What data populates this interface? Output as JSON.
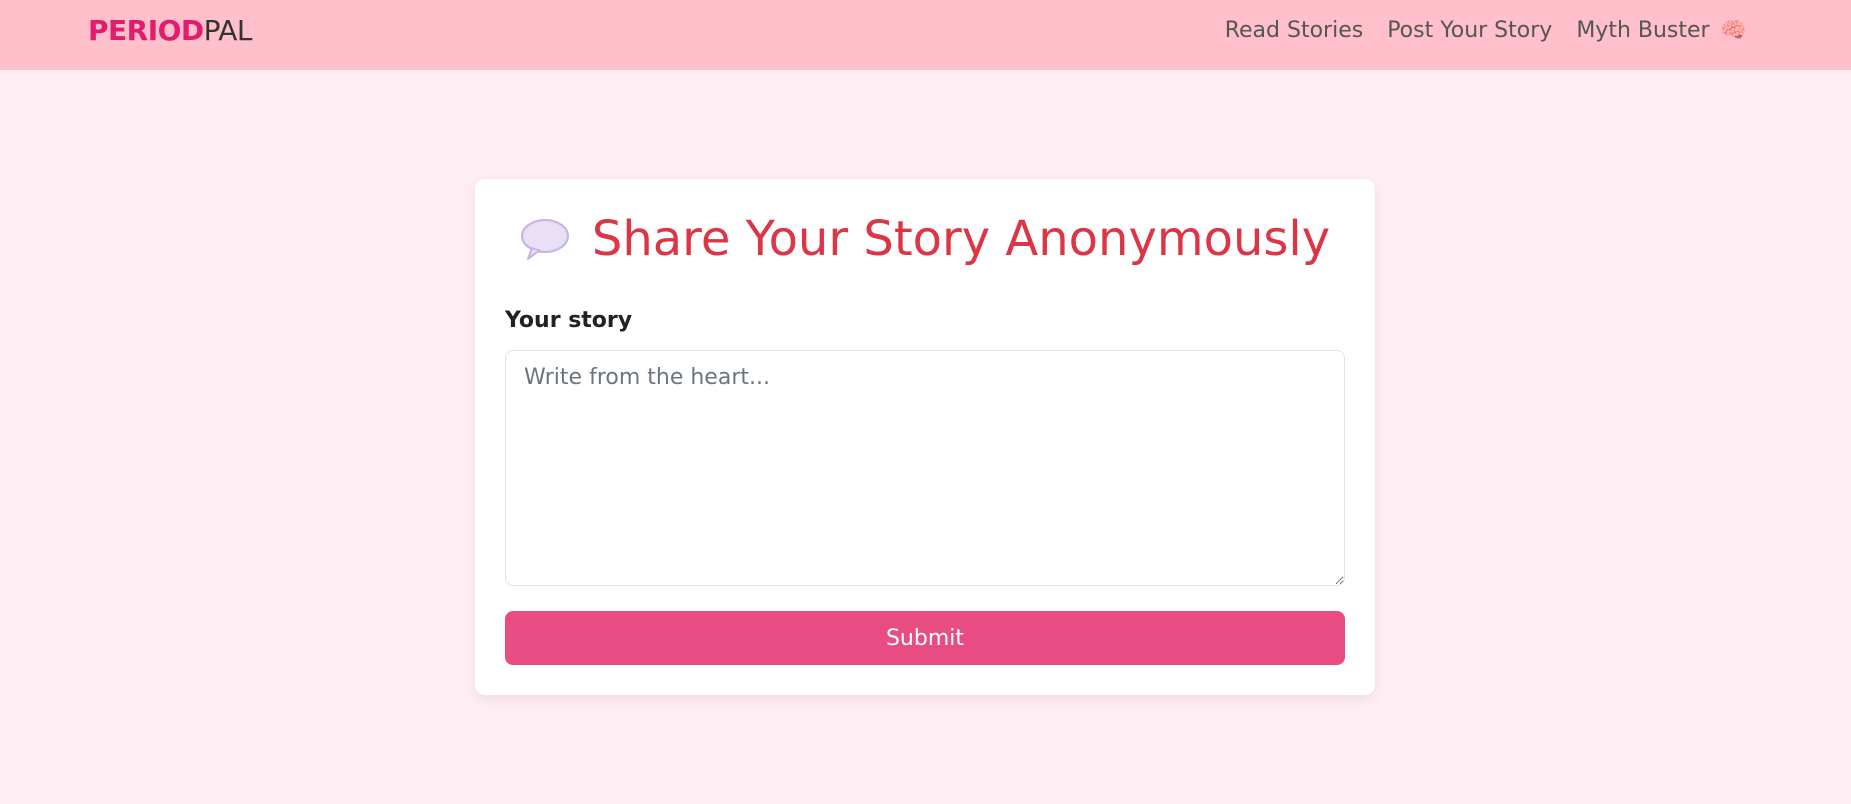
{
  "brand": {
    "part1": "PERIOD",
    "part2": "PAL"
  },
  "nav": {
    "read": "Read Stories",
    "post": "Post Your Story",
    "myth": "Myth Buster",
    "myth_icon": "brain-icon"
  },
  "card": {
    "title": "Share Your Story Anonymously",
    "title_icon": "speech-bubble-icon",
    "label": "Your story",
    "placeholder": "Write from the heart...",
    "submit": "Submit"
  },
  "colors": {
    "navbar_bg": "#ffc0cb",
    "page_bg": "#ffeef3",
    "brand_accent": "#e31b6d",
    "title": "#dc3545",
    "button": "#e84c83"
  }
}
